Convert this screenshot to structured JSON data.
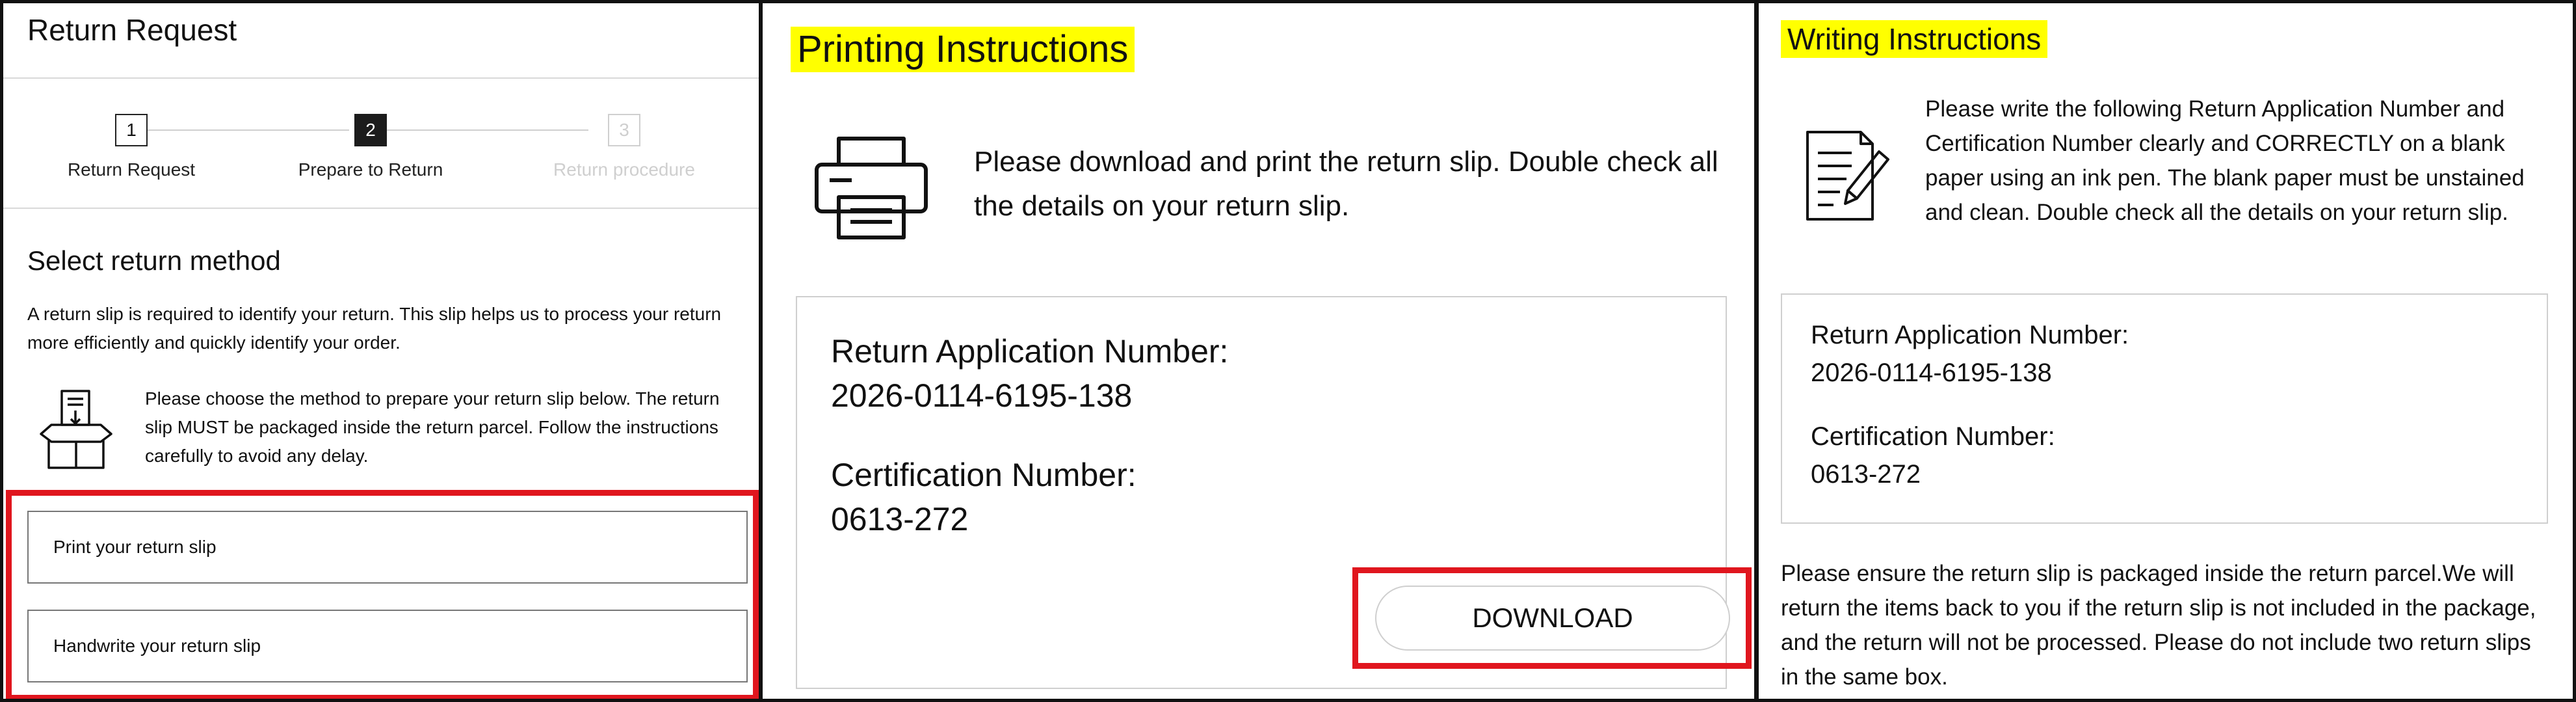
{
  "return_request": {
    "title": "Return Request",
    "steps": [
      {
        "number": "1",
        "label": "Return Request",
        "state": "done"
      },
      {
        "number": "2",
        "label": "Prepare to Return",
        "state": "active"
      },
      {
        "number": "3",
        "label": "Return procedure",
        "state": "disabled"
      }
    ],
    "section_title": "Select return method",
    "description": "A return slip is required to identify your return. This slip helps us to process your return more efficiently and quickly identify your order.",
    "note": "Please choose the method to prepare your return slip below. The return slip MUST be packaged inside the return parcel. Follow the instructions carefully to avoid any delay.",
    "options": [
      "Print your return slip",
      "Handwrite your return slip"
    ]
  },
  "printing": {
    "title": "Printing Instructions",
    "text": "Please download and print the return slip. Double check all the details on your return slip.",
    "app_number_label": "Return Application Number:",
    "app_number": "2026-0114-6195-138",
    "cert_label": "Certification Number:",
    "cert_number": "0613-272",
    "download_label": "DOWNLOAD"
  },
  "writing": {
    "title": "Writing Instructions",
    "text": "Please write the following Return Application Number and Certification Number clearly and CORRECTLY on a blank paper using an ink pen. The blank paper must be unstained and clean. Double check all the details on your return slip.",
    "app_number_label": "Return Application Number:",
    "app_number": "2026-0114-6195-138",
    "cert_label": "Certification Number:",
    "cert_number": "0613-272",
    "footer": "Please ensure the return slip is packaged inside the return parcel.We will return the items back to you if the return slip is not included in the package, and the return will not be processed. Please do not include two return slips in the same box."
  },
  "colors": {
    "highlight": "#ffff00",
    "alert_frame": "#e0161e",
    "active_step": "#1c1c1c",
    "disabled": "#cfcfcf"
  },
  "icons": [
    "box-return-slip-icon",
    "printer-icon",
    "writing-document-icon"
  ]
}
